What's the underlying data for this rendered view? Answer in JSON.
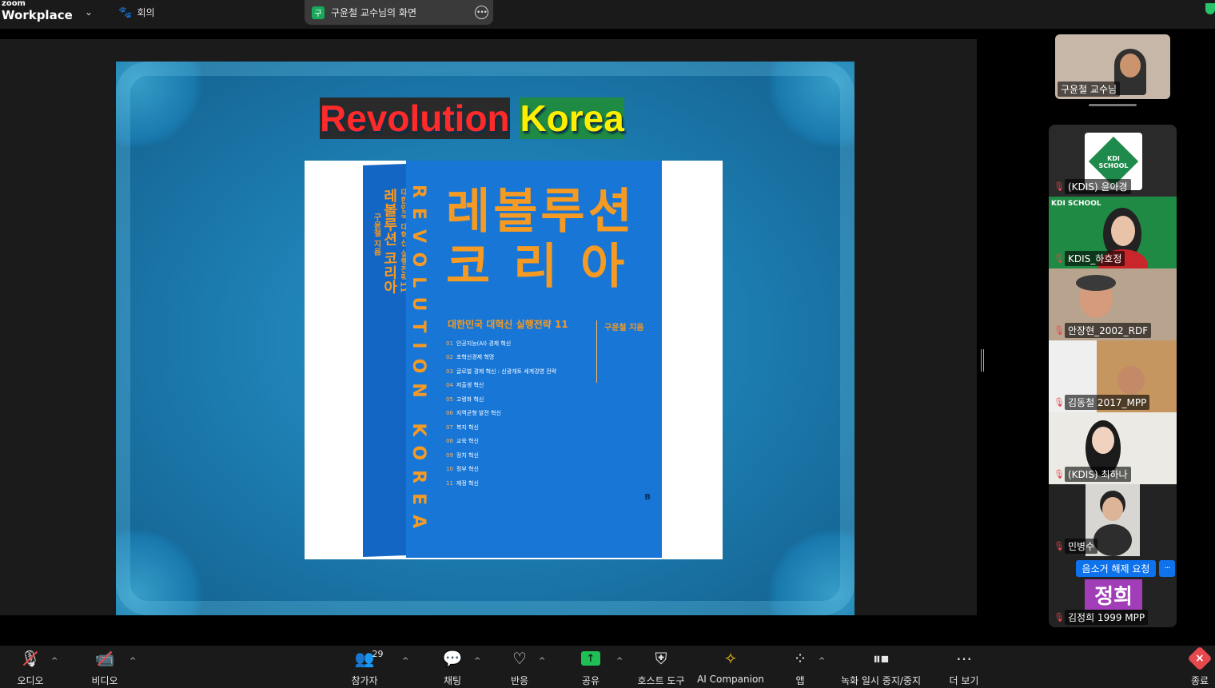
{
  "app": {
    "brand_top": "zoom",
    "brand_bottom": "Workplace",
    "meeting_tab": "회의"
  },
  "share_pill": {
    "avatar_char": "구",
    "label": "구윤철 교수님의 화면"
  },
  "slide": {
    "title_part1": "Revolution",
    "title_part2": "Korea",
    "book": {
      "spine_small": "대한민국 대혁신 실행전략11",
      "spine_title": "레볼루션 코리아",
      "spine_author": "구윤철 지음",
      "vertical_en": "REVOLUTION KOREA",
      "title_line1": "레볼루션",
      "title_line2": "코 리 아",
      "subtitle": "대한민국 대혁신 실행전략 11",
      "author": "구윤철 지음",
      "toc": [
        {
          "n": "01",
          "t": "인공지능(AI) 경제 혁신"
        },
        {
          "n": "02",
          "t": "초혁신경제 혁명"
        },
        {
          "n": "03",
          "t": "글로벌 경제 혁신 : 신광개토 세계경영 전략"
        },
        {
          "n": "04",
          "t": "저출생 혁신"
        },
        {
          "n": "05",
          "t": "고령화 혁신"
        },
        {
          "n": "06",
          "t": "지역균형 발전 혁신"
        },
        {
          "n": "07",
          "t": "복지 혁신"
        },
        {
          "n": "08",
          "t": "교육 혁신"
        },
        {
          "n": "09",
          "t": "정치 혁신"
        },
        {
          "n": "10",
          "t": "정부 혁신"
        },
        {
          "n": "11",
          "t": "재정 혁신"
        }
      ],
      "publisher_mark": "B"
    }
  },
  "self_view": {
    "name": "구윤철 교수님"
  },
  "participants": [
    {
      "name": "(KDIS) 윤아경",
      "logo_text": "KDI SCHOOL"
    },
    {
      "name": "KDIS_하호정",
      "banner": "KDI SCHOOL"
    },
    {
      "name": "안장현_2002_RDF"
    },
    {
      "name": "김동철 2017_MPP"
    },
    {
      "name": "(KDIS) 최하나"
    },
    {
      "name": "민병수"
    },
    {
      "name": "김정희 1999 MPP",
      "chip": "정희"
    }
  ],
  "unmute_request": {
    "label": "음소거 해제 요청",
    "more": "···"
  },
  "toolbar": {
    "audio": "오디오",
    "video": "비디오",
    "participants": "참가자",
    "participants_count": "29",
    "chat": "채팅",
    "reactions": "반응",
    "share": "공유",
    "host_tools": "호스트 도구",
    "ai_companion": "AI Companion",
    "apps": "앱",
    "recording": "녹화 일시 중지/중지",
    "more": "더 보기",
    "end": "종료"
  },
  "colors": {
    "accent_blue": "#0e72ed",
    "share_green": "#1fbf55",
    "muted_red": "#e5484d",
    "book_blue": "#1876d6",
    "book_orange": "#f59a23"
  }
}
